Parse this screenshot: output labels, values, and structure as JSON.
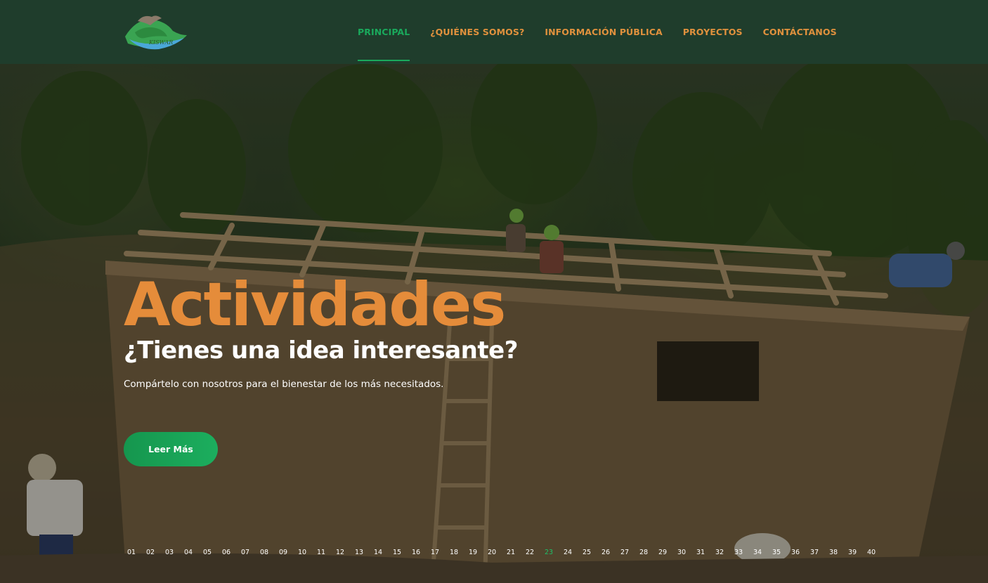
{
  "header": {
    "logo_text": "KISWAR",
    "nav": [
      {
        "label": "PRINCIPAL",
        "active": true
      },
      {
        "label": "¿QUIÉNES SOMOS?",
        "active": false
      },
      {
        "label": "INFORMACIÓN PÚBLICA",
        "active": false
      },
      {
        "label": "PROYECTOS",
        "active": false
      },
      {
        "label": "CONTÁCTANOS",
        "active": false
      }
    ]
  },
  "hero": {
    "title": "Actividades",
    "subtitle": "¿Tienes una idea interesante?",
    "text": "Compártelo con nosotros para el bienestar de los más necesitados.",
    "button_label": "Leer Más"
  },
  "pager": {
    "active_index": 22,
    "items": [
      "01",
      "02",
      "03",
      "04",
      "05",
      "06",
      "07",
      "08",
      "09",
      "10",
      "11",
      "12",
      "13",
      "14",
      "15",
      "16",
      "17",
      "18",
      "19",
      "20",
      "21",
      "22",
      "23",
      "24",
      "25",
      "26",
      "27",
      "28",
      "29",
      "30",
      "31",
      "32",
      "33",
      "34",
      "35",
      "36",
      "37",
      "38",
      "39",
      "40"
    ]
  },
  "colors": {
    "header_bg": "#1f3d2c",
    "nav_text": "#e0913d",
    "nav_active": "#1aa95c",
    "title_orange": "#e58c3a",
    "button_green": "#1aa95c",
    "pager_active": "#1fbf68"
  }
}
